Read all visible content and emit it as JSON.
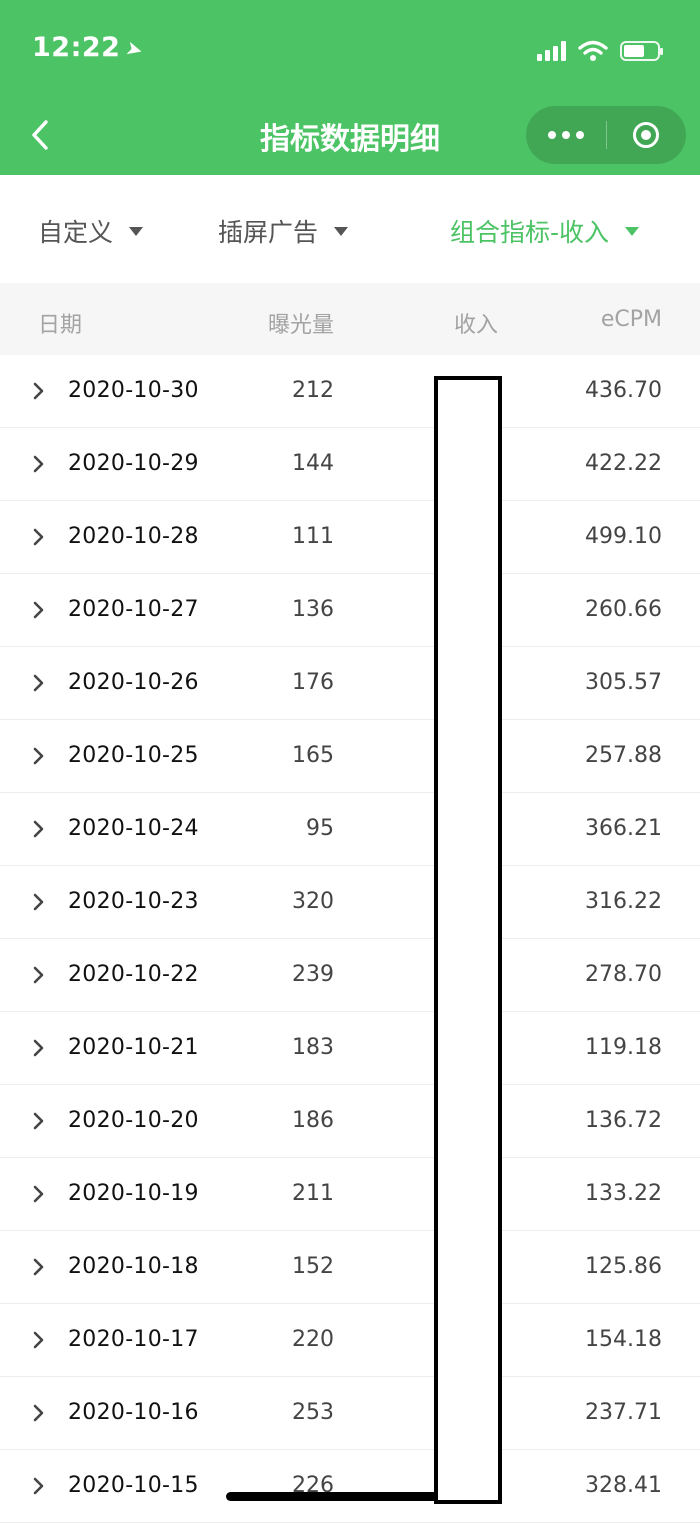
{
  "status_bar": {
    "time": "12:22",
    "location_icon": "location-arrow-icon",
    "signal_icon": "signal-icon",
    "wifi_icon": "wifi-icon",
    "battery_icon": "battery-icon"
  },
  "nav": {
    "title": "指标数据明细",
    "back_icon": "back-chevron-icon",
    "more_icon": "more-dots-icon",
    "close_icon": "close-miniprogram-icon"
  },
  "filters": [
    {
      "label": "自定义",
      "active": false
    },
    {
      "label": "插屏广告",
      "active": false
    },
    {
      "label": "组合指标-收入",
      "active": true
    }
  ],
  "colors": {
    "brand_green": "#4cc364",
    "header_text": "#ffffff",
    "muted": "#a3a3a3"
  },
  "table": {
    "headers": {
      "date": "日期",
      "impressions": "曝光量",
      "revenue": "收入",
      "ecpm": "eCPM"
    },
    "rows": [
      {
        "date": "2020-10-30",
        "impressions": "212",
        "ecpm": "436.70"
      },
      {
        "date": "2020-10-29",
        "impressions": "144",
        "ecpm": "422.22"
      },
      {
        "date": "2020-10-28",
        "impressions": "111",
        "ecpm": "499.10"
      },
      {
        "date": "2020-10-27",
        "impressions": "136",
        "ecpm": "260.66"
      },
      {
        "date": "2020-10-26",
        "impressions": "176",
        "ecpm": "305.57"
      },
      {
        "date": "2020-10-25",
        "impressions": "165",
        "ecpm": "257.88"
      },
      {
        "date": "2020-10-24",
        "impressions": "95",
        "ecpm": "366.21"
      },
      {
        "date": "2020-10-23",
        "impressions": "320",
        "ecpm": "316.22"
      },
      {
        "date": "2020-10-22",
        "impressions": "239",
        "ecpm": "278.70"
      },
      {
        "date": "2020-10-21",
        "impressions": "183",
        "ecpm": "119.18"
      },
      {
        "date": "2020-10-20",
        "impressions": "186",
        "ecpm": "136.72"
      },
      {
        "date": "2020-10-19",
        "impressions": "211",
        "ecpm": "133.22"
      },
      {
        "date": "2020-10-18",
        "impressions": "152",
        "ecpm": "125.86"
      },
      {
        "date": "2020-10-17",
        "impressions": "220",
        "ecpm": "154.18"
      },
      {
        "date": "2020-10-16",
        "impressions": "253",
        "ecpm": "237.71"
      },
      {
        "date": "2020-10-15",
        "impressions": "226",
        "ecpm": "328.41"
      }
    ]
  }
}
